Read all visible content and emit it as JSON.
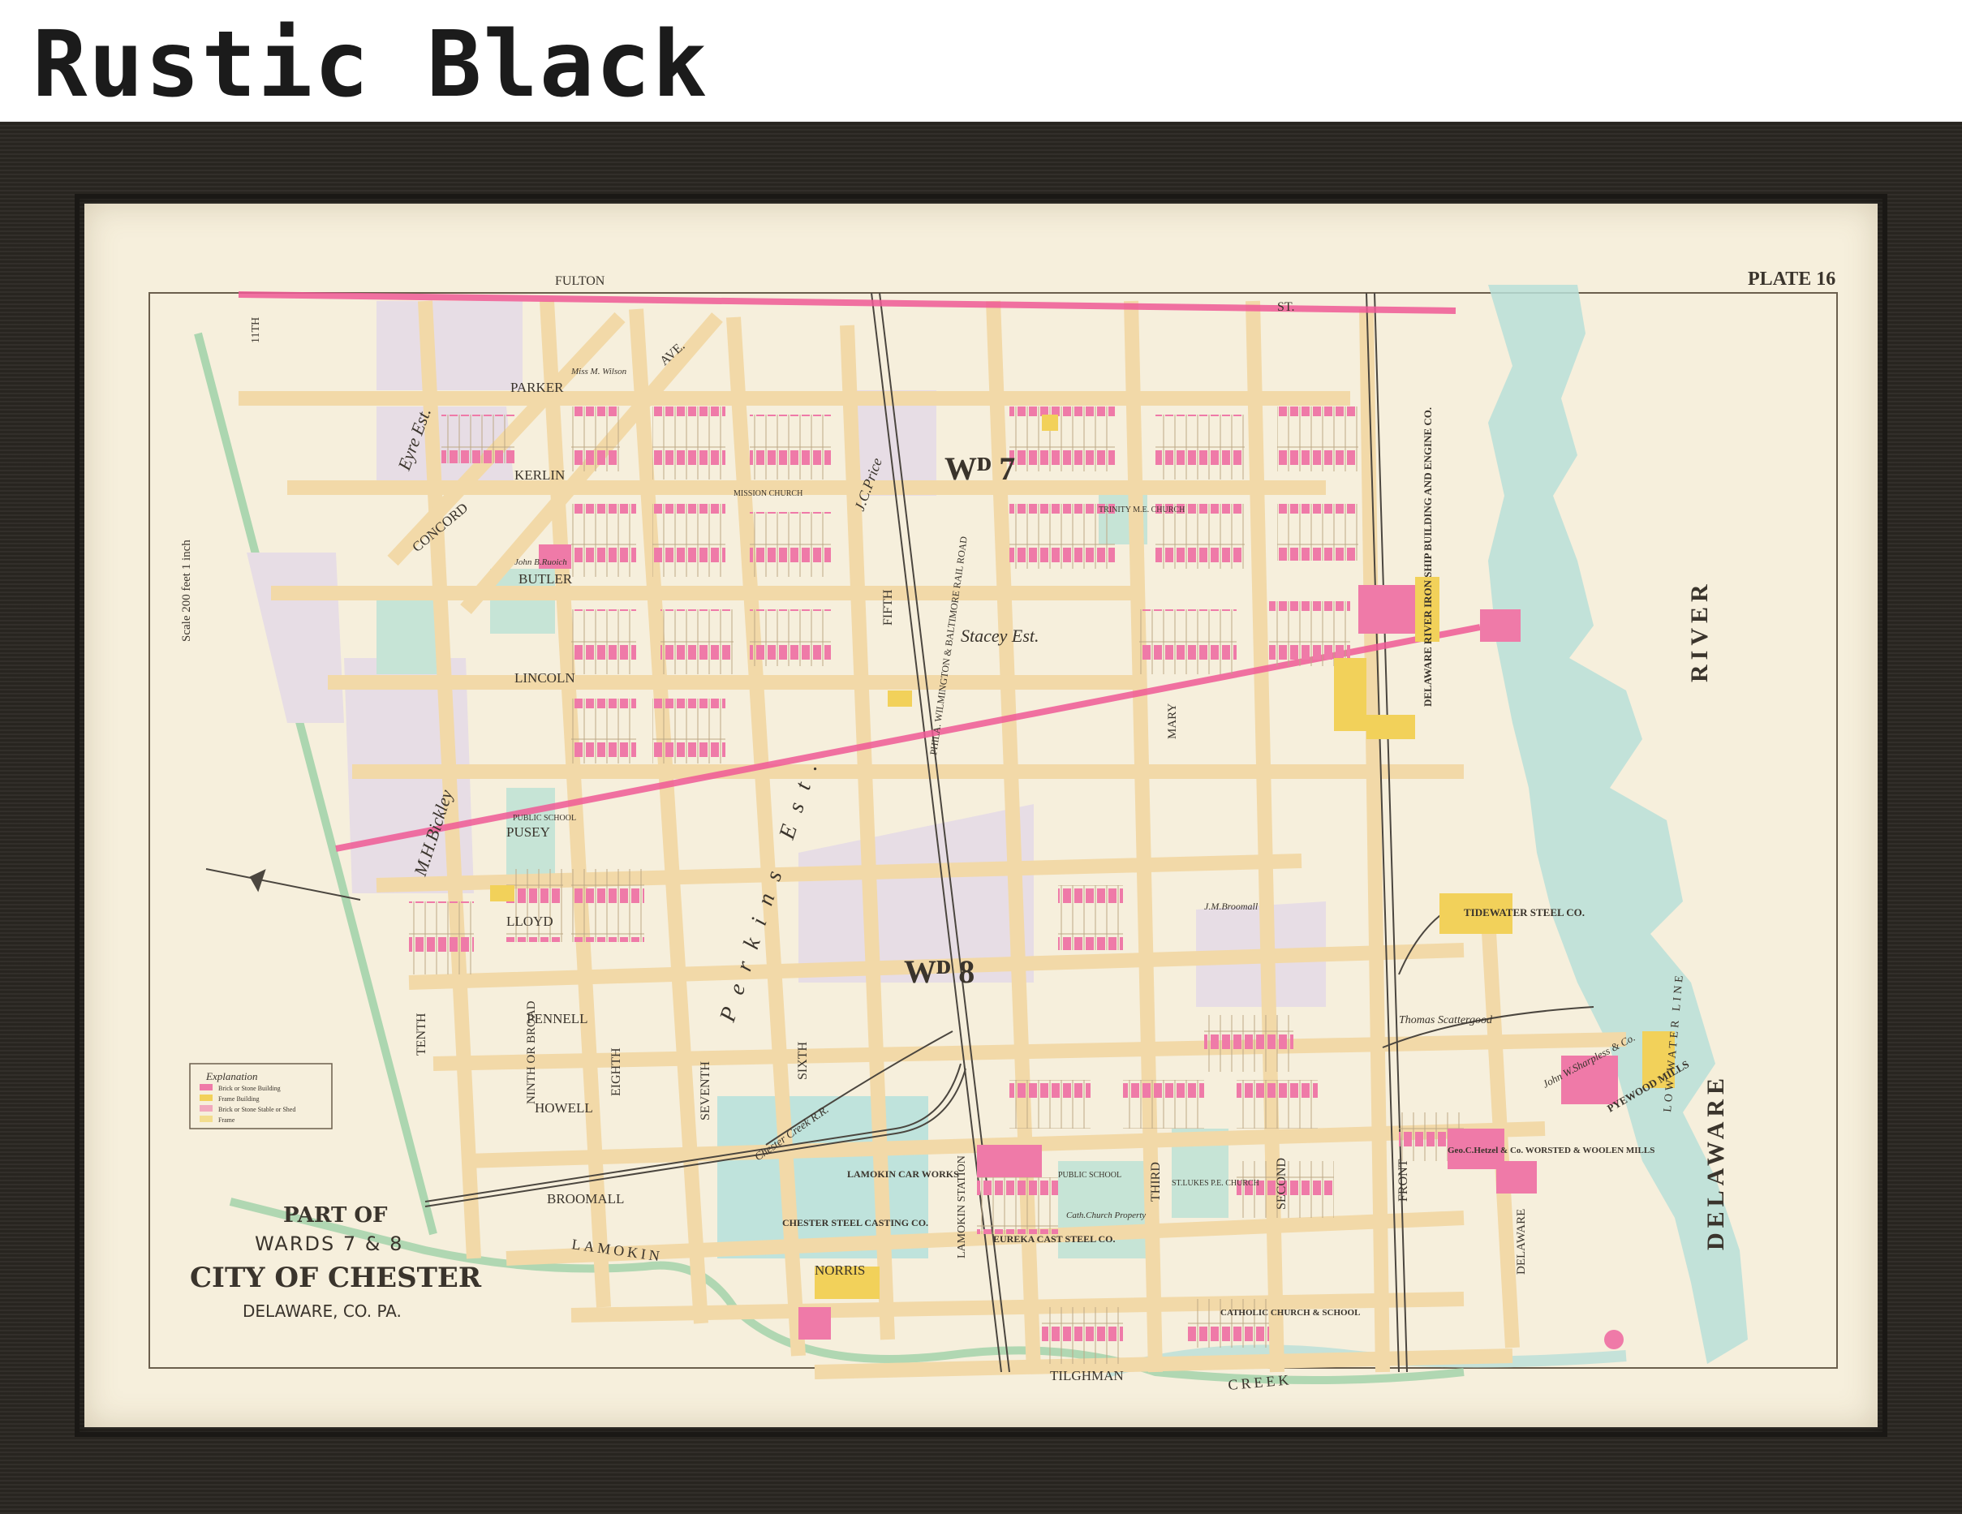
{
  "frame_label": "Rustic Black",
  "map": {
    "plate": "PLATE 16",
    "scale": "Scale 200 feet 1 inch",
    "title_part": "PART OF",
    "title_wards": "WARDS 7 & 8",
    "title_city": "CITY OF CHESTER",
    "title_county": "DELAWARE, CO. PA.",
    "ward7": "Wᴰ 7",
    "ward8": "Wᴰ 8",
    "river_word1": "RIVER",
    "river_word2": "DELAWARE",
    "low_water": "LOW   WATER   LINE",
    "creek_word1": "LAMOKIN",
    "creek_word2": "CREEK",
    "explanation": {
      "title": "Explanation",
      "items": [
        "Brick or Stone Building",
        "Frame Building",
        "Brick or Stone Stable or Shed",
        "Frame"
      ]
    },
    "streets": {
      "fulton": "FULTON",
      "st1": "ST.",
      "eleventh": "11TH",
      "parker": "PARKER",
      "kerlin": "KERLIN",
      "concord": "CONCORD",
      "butler": "BUTLER",
      "lincoln": "LINCOLN",
      "pusey": "PUSEY",
      "lloyd": "LLOYD",
      "pennell": "PENNELL",
      "howell": "HOWELL",
      "broomall": "BROOMALL",
      "norris": "NORRIS",
      "tilghman": "TILGHMAN",
      "tenth": "TENTH",
      "ninth": "NINTH OR BROAD",
      "eighth": "EIGHTH",
      "seventh": "SEVENTH",
      "sixth": "SIXTH",
      "fifth": "FIFTH",
      "third": "THIRD",
      "second": "SECOND",
      "front": "FRONT",
      "delaware_st": "DELAWARE",
      "mary": "MARY",
      "ave": "AVE.",
      "lamokin_station": "LAMOKIN STATION",
      "stacey": "Stacey Est.",
      "eyre": "Eyre Est.",
      "perkins": "Perkins Est.",
      "bickley": "M.H.Bickley",
      "price": "J.C.Price",
      "railroad": "PHILA. WILMINGTON & BALTIMORE RAIL ROAD",
      "chester_creek_rr": "Chester Creek R.R."
    },
    "labels": {
      "tidewater": "TIDEWATER STEEL CO.",
      "iron_ship": "DELAWARE RIVER IRON SHIP BUILDING AND ENGINE CO.",
      "eureka": "EUREKA CAST STEEL CO.",
      "lamokin_works": "LAMOKIN CAR WORKS",
      "chester_steel": "CHESTER STEEL CASTING CO.",
      "worsted": "Geo.C.Hetzel & Co. WORSTED & WOOLEN MILLS",
      "pyewood": "PYEWOOD MILLS",
      "sharpless": "John W.Sharpless & Co.",
      "catholic": "CATHOLIC CHURCH & SCHOOL",
      "public_school1": "PUBLIC SCHOOL",
      "public_school2": "PUBLIC SCHOOL",
      "trinity": "TRINITY M.E. CHURCH",
      "mission": "MISSION CHURCH",
      "cath_church": "Cath.Church Property",
      "st_lukes": "ST.LUKES P.E. CHURCH",
      "scattergood": "Thomas Scattergood",
      "broomall": "J.M.Broomall",
      "wilson": "Miss M. Wilson",
      "ruoich": "John B.Ruoich"
    }
  },
  "colors": {
    "frame": "#2a2722",
    "paper": "#f6efdc",
    "street": "#f2d9a8",
    "brick": "#ef7aa8",
    "frame_bldg": "#f2d15a",
    "ward_line": "#f05a96",
    "water": "#b9dfd8",
    "block": "#e7dde5"
  }
}
